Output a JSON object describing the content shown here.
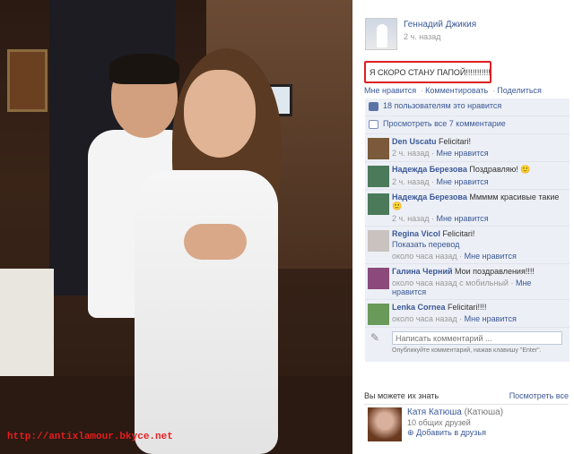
{
  "watermark": "http://antixlamour.bkyce.net",
  "post": {
    "author": "Геннадий Джикия",
    "time": "2 ч. назад",
    "text": "Я СКОРО СТАНУ ПАПОЙ!!!!!!!!!!!",
    "actions": [
      "Мне нравится",
      "Комментировать",
      "Поделиться"
    ],
    "likes_text": "18 пользователям это нравится",
    "view_comments": "Просмотреть все 7 комментарие"
  },
  "comments": [
    {
      "name": "Den Uscatu",
      "text": "Felicitari!",
      "time": "2 ч. назад",
      "like": "Мне нравится",
      "sub": ""
    },
    {
      "name": "Надежда Березова",
      "text": "Поздравляю! 🙂",
      "time": "2 ч. назад",
      "like": "Мне нравится",
      "sub": ""
    },
    {
      "name": "Надежда Березова",
      "text": "Ммммм красивые такие 🙂",
      "time": "2 ч. назад",
      "like": "Мне нравится",
      "sub": ""
    },
    {
      "name": "Regina Vicol",
      "text": "Felicitari!",
      "time": "около часа назад",
      "like": "Мне нравится",
      "sub": "Показать перевод"
    },
    {
      "name": "Галина Черний",
      "text": "Мои поздравления!!!!",
      "time": "около часа назад с мобильный",
      "like": "Мне нравится",
      "sub": ""
    },
    {
      "name": "Lenka Cornea",
      "text": "Felicitari!!!!",
      "time": "около часа назад",
      "like": "Мне нравится",
      "sub": ""
    }
  ],
  "composer": {
    "placeholder": "Написать комментарий ...",
    "hint": "Опубликуйте комментарий, нажав клавишу \"Enter\"."
  },
  "suggestions": {
    "title": "Вы можете их знать",
    "see_all": "Посмотреть все",
    "person": {
      "name": "Катя Катюша",
      "alt_name": "(Катюша)",
      "mutual": "10 общих друзей",
      "add": "Добавить в друзья"
    }
  },
  "colors": {
    "link": "#3b5998",
    "highlight": "#e02020",
    "watermark": "#e81c1c"
  }
}
